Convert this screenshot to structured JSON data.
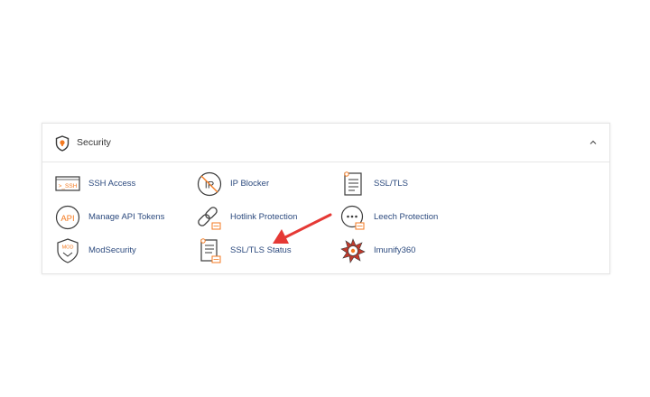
{
  "section": {
    "title": "Security",
    "icon": "shield-icon",
    "collapse_icon": "chevron-up-icon"
  },
  "items": [
    {
      "label": "SSH Access",
      "icon": "ssh-terminal-icon"
    },
    {
      "label": "IP Blocker",
      "icon": "ip-blocker-icon"
    },
    {
      "label": "SSL/TLS",
      "icon": "certificate-icon"
    },
    {
      "label": "Manage API Tokens",
      "icon": "api-icon"
    },
    {
      "label": "Hotlink Protection",
      "icon": "broken-link-icon"
    },
    {
      "label": "Leech Protection",
      "icon": "leech-icon"
    },
    {
      "label": "ModSecurity",
      "icon": "modsecurity-shield-icon"
    },
    {
      "label": "SSL/TLS Status",
      "icon": "ssl-status-icon"
    },
    {
      "label": "Imunify360",
      "icon": "imunify360-icon"
    }
  ],
  "icon_text": {
    "ssh": ">_SSH",
    "ip": "IP",
    "api": "API",
    "mod": "MOD"
  },
  "colors": {
    "accent": "#f47a20",
    "icon_dark": "#3a3a3a",
    "link": "#2c4a7e",
    "arrow": "#e53935"
  }
}
